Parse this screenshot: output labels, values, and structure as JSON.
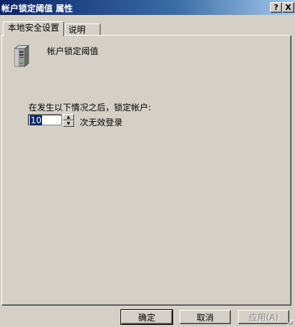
{
  "window": {
    "title": "帐户锁定阈值 属性",
    "help_glyph": "?",
    "close_glyph": "X"
  },
  "tabs": [
    {
      "label": "本地安全设置",
      "active": true
    },
    {
      "label": "说明",
      "active": false
    }
  ],
  "policy": {
    "icon": "server-icon",
    "name": "帐户锁定阈值"
  },
  "lockout": {
    "prompt": "在发生以下情况之后，锁定帐户:",
    "value": "10",
    "unit": "次无效登录"
  },
  "buttons": {
    "ok": "确定",
    "cancel": "取消",
    "apply": "应用(A)"
  }
}
